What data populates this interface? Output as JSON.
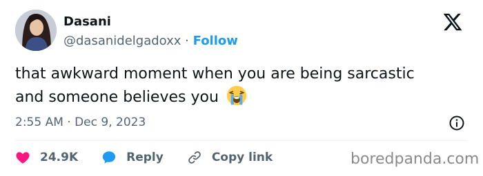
{
  "tweet": {
    "author_name": "Dasani",
    "handle": "@dasanidelgadoxx",
    "separator": "·",
    "follow_label": "Follow",
    "text": "that awkward moment when you are being sarcastic and someone believes you",
    "emoji": "loudly-crying-face",
    "timestamp": "2:55 AM · Dec 9, 2023"
  },
  "actions": {
    "likes_count": "24.9K",
    "reply_label": "Reply",
    "copy_link_label": "Copy link"
  },
  "watermark": "boredpanda.com",
  "colors": {
    "follow_blue": "#1d9bf0",
    "like_pink": "#f91880",
    "muted_gray": "#536471"
  }
}
